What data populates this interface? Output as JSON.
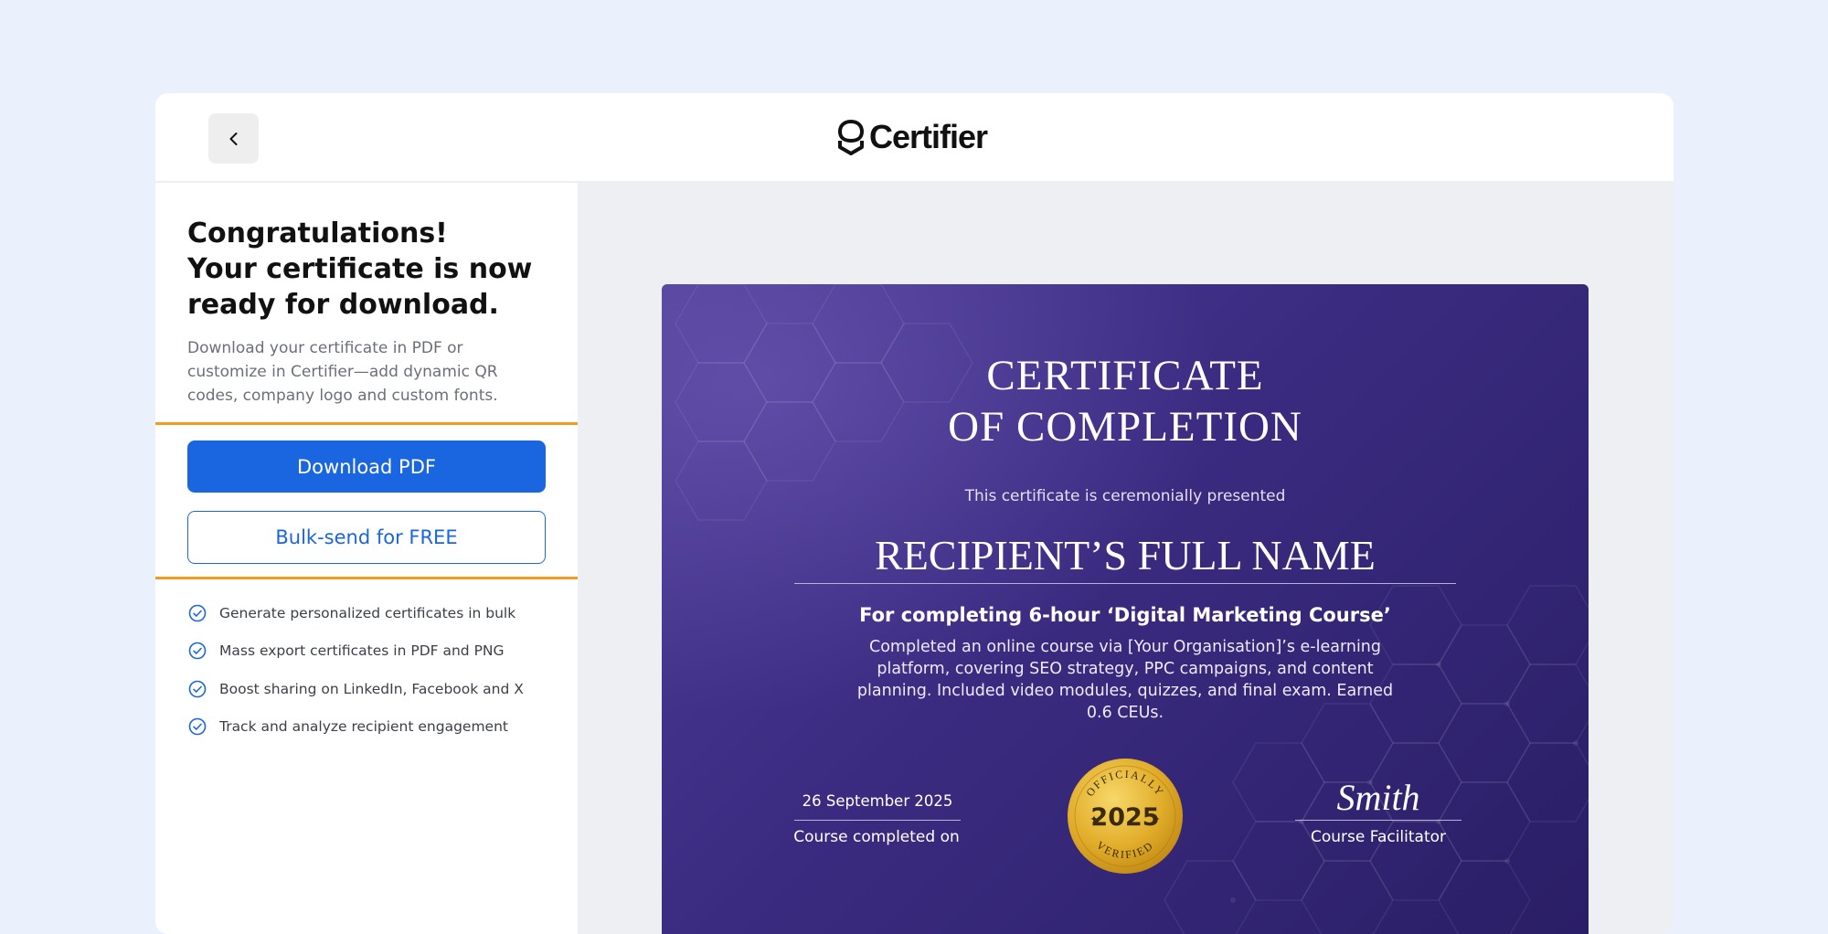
{
  "app": {
    "brand": "Certifier",
    "colors": {
      "accent": "#1a66e0",
      "highlight": "#f29b22",
      "certificate_bg": "#3c2c82",
      "seal_gold": "#e7b531"
    }
  },
  "topbar": {
    "back_icon": "chevron-left-icon",
    "logo_icon": "certifier-logo-icon"
  },
  "sidebar": {
    "headline": [
      "Congratulations!",
      "Your certificate is now",
      "ready for download."
    ],
    "description": "Download your certificate in PDF or customize in Certifier—add dynamic QR codes, company logo and custom fonts.",
    "download_label": "Download PDF",
    "bulk_send_label": "Bulk-send for FREE",
    "features": [
      "Generate personalized certificates in bulk",
      "Mass export certificates in PDF and PNG",
      "Boost sharing on LinkedIn, Facebook and X",
      "Track and analyze recipient engagement"
    ]
  },
  "certificate": {
    "title": [
      "CERTIFICATE",
      "OF COMPLETION"
    ],
    "presented": "This certificate is ceremonially presented",
    "recipient": "RECIPIENT’S FULL NAME",
    "course_title": "For completing 6-hour ‘Digital Marketing Course’",
    "course_description": "Completed an online course via [Your Organisation]’s e-learning platform, covering SEO strategy, PPC campaigns, and content planning. Included video modules, quizzes, and final exam. Earned 0.6 CEUs.",
    "date_value": "26 September 2025",
    "date_label": "Course completed on",
    "seal": {
      "top_text": "OFFICIALLY",
      "year": "2025",
      "bottom_text": "VERIFIED"
    },
    "signature": "Smith",
    "signature_label": "Course Facilitator"
  }
}
